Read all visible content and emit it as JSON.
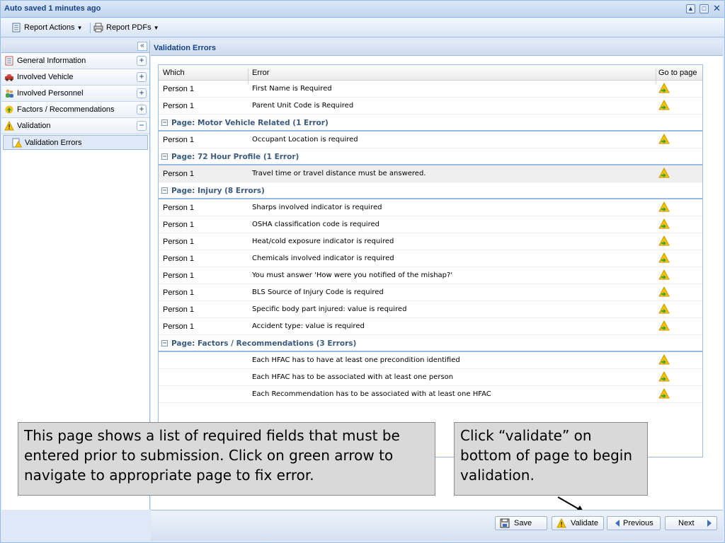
{
  "window": {
    "title": "Auto saved 1 minutes ago"
  },
  "toolbar": {
    "report_actions": "Report Actions",
    "report_pdfs": "Report PDFs"
  },
  "sidebar": {
    "items": [
      {
        "label": "General Information",
        "toggle": "+"
      },
      {
        "label": "Involved Vehicle",
        "toggle": "+"
      },
      {
        "label": "Involved Personnel",
        "toggle": "+"
      },
      {
        "label": "Factors / Recommendations",
        "toggle": "+"
      },
      {
        "label": "Validation",
        "toggle": "−"
      }
    ],
    "subitem": "Validation Errors"
  },
  "panel": {
    "title": "Validation Errors"
  },
  "grid": {
    "columns": [
      "Which",
      "Error",
      "Go to page"
    ],
    "top_rows": [
      {
        "which": "Person 1",
        "error": "First Name is Required"
      },
      {
        "which": "Person 1",
        "error": "Parent Unit Code is Required"
      }
    ],
    "groups": [
      {
        "title": "Page: Motor Vehicle Related (1 Error)",
        "rows": [
          {
            "which": "Person 1",
            "error": "Occupant Location is required"
          }
        ]
      },
      {
        "title": "Page: 72 Hour Profile (1 Error)",
        "rows": [
          {
            "which": "Person 1",
            "error": "Travel time or travel distance must be answered."
          }
        ]
      },
      {
        "title": "Page: Injury (8 Errors)",
        "rows": [
          {
            "which": "Person 1",
            "error": "Sharps involved indicator is required"
          },
          {
            "which": "Person 1",
            "error": "OSHA classification code is required"
          },
          {
            "which": "Person 1",
            "error": "Heat/cold exposure indicator is required"
          },
          {
            "which": "Person 1",
            "error": "Chemicals involved indicator is required"
          },
          {
            "which": "Person 1",
            "error": "You must answer 'How were you notified of the mishap?'"
          },
          {
            "which": "Person 1",
            "error": "BLS Source of Injury Code is required"
          },
          {
            "which": "Person 1",
            "error": "Specific body part injured: value is required"
          },
          {
            "which": "Person 1",
            "error": "Accident type: value is required"
          }
        ]
      },
      {
        "title": "Page: Factors / Recommendations (3 Errors)",
        "rows": [
          {
            "which": "",
            "error": "Each HFAC has to have at least one precondition identified"
          },
          {
            "which": "",
            "error": "Each HFAC has to be associated with at least one person"
          },
          {
            "which": "",
            "error": "Each Recommendation has to be associated with at least one HFAC"
          }
        ]
      }
    ]
  },
  "callouts": {
    "left": "This page shows a list of required fields that must be entered prior to submission.  Click on green arrow to navigate to appropriate page to fix error.",
    "right": "Click “validate” on bottom of page to begin validation."
  },
  "bottom": {
    "save": "Save",
    "validate": "Validate",
    "previous": "Previous",
    "next": "Next"
  },
  "colors": {
    "accent": "#15428b",
    "border": "#99bbe8",
    "panel_bg": "#dfe8f6"
  }
}
